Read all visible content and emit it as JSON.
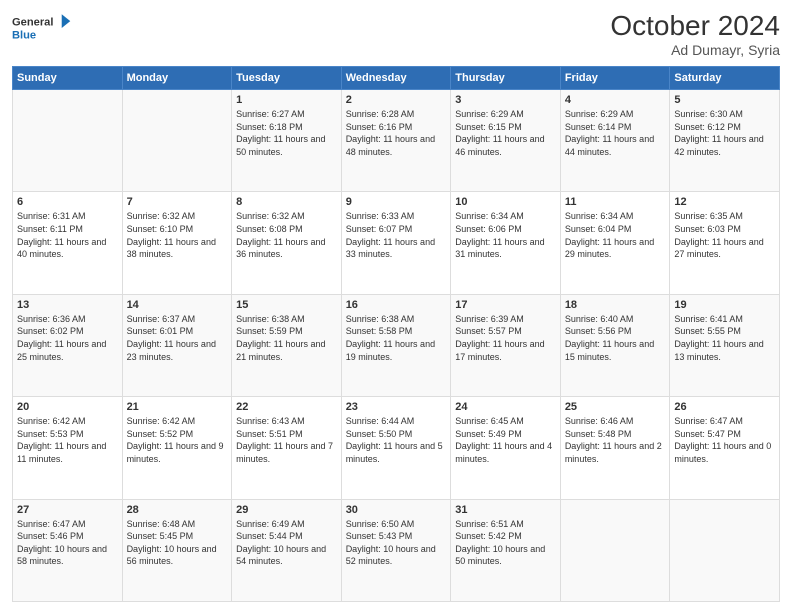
{
  "header": {
    "logo_line1": "General",
    "logo_line2": "Blue",
    "month_title": "October 2024",
    "subtitle": "Ad Dumayr, Syria"
  },
  "weekdays": [
    "Sunday",
    "Monday",
    "Tuesday",
    "Wednesday",
    "Thursday",
    "Friday",
    "Saturday"
  ],
  "weeks": [
    [
      {
        "day": "",
        "info": ""
      },
      {
        "day": "",
        "info": ""
      },
      {
        "day": "1",
        "info": "Sunrise: 6:27 AM\nSunset: 6:18 PM\nDaylight: 11 hours and 50 minutes."
      },
      {
        "day": "2",
        "info": "Sunrise: 6:28 AM\nSunset: 6:16 PM\nDaylight: 11 hours and 48 minutes."
      },
      {
        "day": "3",
        "info": "Sunrise: 6:29 AM\nSunset: 6:15 PM\nDaylight: 11 hours and 46 minutes."
      },
      {
        "day": "4",
        "info": "Sunrise: 6:29 AM\nSunset: 6:14 PM\nDaylight: 11 hours and 44 minutes."
      },
      {
        "day": "5",
        "info": "Sunrise: 6:30 AM\nSunset: 6:12 PM\nDaylight: 11 hours and 42 minutes."
      }
    ],
    [
      {
        "day": "6",
        "info": "Sunrise: 6:31 AM\nSunset: 6:11 PM\nDaylight: 11 hours and 40 minutes."
      },
      {
        "day": "7",
        "info": "Sunrise: 6:32 AM\nSunset: 6:10 PM\nDaylight: 11 hours and 38 minutes."
      },
      {
        "day": "8",
        "info": "Sunrise: 6:32 AM\nSunset: 6:08 PM\nDaylight: 11 hours and 36 minutes."
      },
      {
        "day": "9",
        "info": "Sunrise: 6:33 AM\nSunset: 6:07 PM\nDaylight: 11 hours and 33 minutes."
      },
      {
        "day": "10",
        "info": "Sunrise: 6:34 AM\nSunset: 6:06 PM\nDaylight: 11 hours and 31 minutes."
      },
      {
        "day": "11",
        "info": "Sunrise: 6:34 AM\nSunset: 6:04 PM\nDaylight: 11 hours and 29 minutes."
      },
      {
        "day": "12",
        "info": "Sunrise: 6:35 AM\nSunset: 6:03 PM\nDaylight: 11 hours and 27 minutes."
      }
    ],
    [
      {
        "day": "13",
        "info": "Sunrise: 6:36 AM\nSunset: 6:02 PM\nDaylight: 11 hours and 25 minutes."
      },
      {
        "day": "14",
        "info": "Sunrise: 6:37 AM\nSunset: 6:01 PM\nDaylight: 11 hours and 23 minutes."
      },
      {
        "day": "15",
        "info": "Sunrise: 6:38 AM\nSunset: 5:59 PM\nDaylight: 11 hours and 21 minutes."
      },
      {
        "day": "16",
        "info": "Sunrise: 6:38 AM\nSunset: 5:58 PM\nDaylight: 11 hours and 19 minutes."
      },
      {
        "day": "17",
        "info": "Sunrise: 6:39 AM\nSunset: 5:57 PM\nDaylight: 11 hours and 17 minutes."
      },
      {
        "day": "18",
        "info": "Sunrise: 6:40 AM\nSunset: 5:56 PM\nDaylight: 11 hours and 15 minutes."
      },
      {
        "day": "19",
        "info": "Sunrise: 6:41 AM\nSunset: 5:55 PM\nDaylight: 11 hours and 13 minutes."
      }
    ],
    [
      {
        "day": "20",
        "info": "Sunrise: 6:42 AM\nSunset: 5:53 PM\nDaylight: 11 hours and 11 minutes."
      },
      {
        "day": "21",
        "info": "Sunrise: 6:42 AM\nSunset: 5:52 PM\nDaylight: 11 hours and 9 minutes."
      },
      {
        "day": "22",
        "info": "Sunrise: 6:43 AM\nSunset: 5:51 PM\nDaylight: 11 hours and 7 minutes."
      },
      {
        "day": "23",
        "info": "Sunrise: 6:44 AM\nSunset: 5:50 PM\nDaylight: 11 hours and 5 minutes."
      },
      {
        "day": "24",
        "info": "Sunrise: 6:45 AM\nSunset: 5:49 PM\nDaylight: 11 hours and 4 minutes."
      },
      {
        "day": "25",
        "info": "Sunrise: 6:46 AM\nSunset: 5:48 PM\nDaylight: 11 hours and 2 minutes."
      },
      {
        "day": "26",
        "info": "Sunrise: 6:47 AM\nSunset: 5:47 PM\nDaylight: 11 hours and 0 minutes."
      }
    ],
    [
      {
        "day": "27",
        "info": "Sunrise: 6:47 AM\nSunset: 5:46 PM\nDaylight: 10 hours and 58 minutes."
      },
      {
        "day": "28",
        "info": "Sunrise: 6:48 AM\nSunset: 5:45 PM\nDaylight: 10 hours and 56 minutes."
      },
      {
        "day": "29",
        "info": "Sunrise: 6:49 AM\nSunset: 5:44 PM\nDaylight: 10 hours and 54 minutes."
      },
      {
        "day": "30",
        "info": "Sunrise: 6:50 AM\nSunset: 5:43 PM\nDaylight: 10 hours and 52 minutes."
      },
      {
        "day": "31",
        "info": "Sunrise: 6:51 AM\nSunset: 5:42 PM\nDaylight: 10 hours and 50 minutes."
      },
      {
        "day": "",
        "info": ""
      },
      {
        "day": "",
        "info": ""
      }
    ]
  ]
}
